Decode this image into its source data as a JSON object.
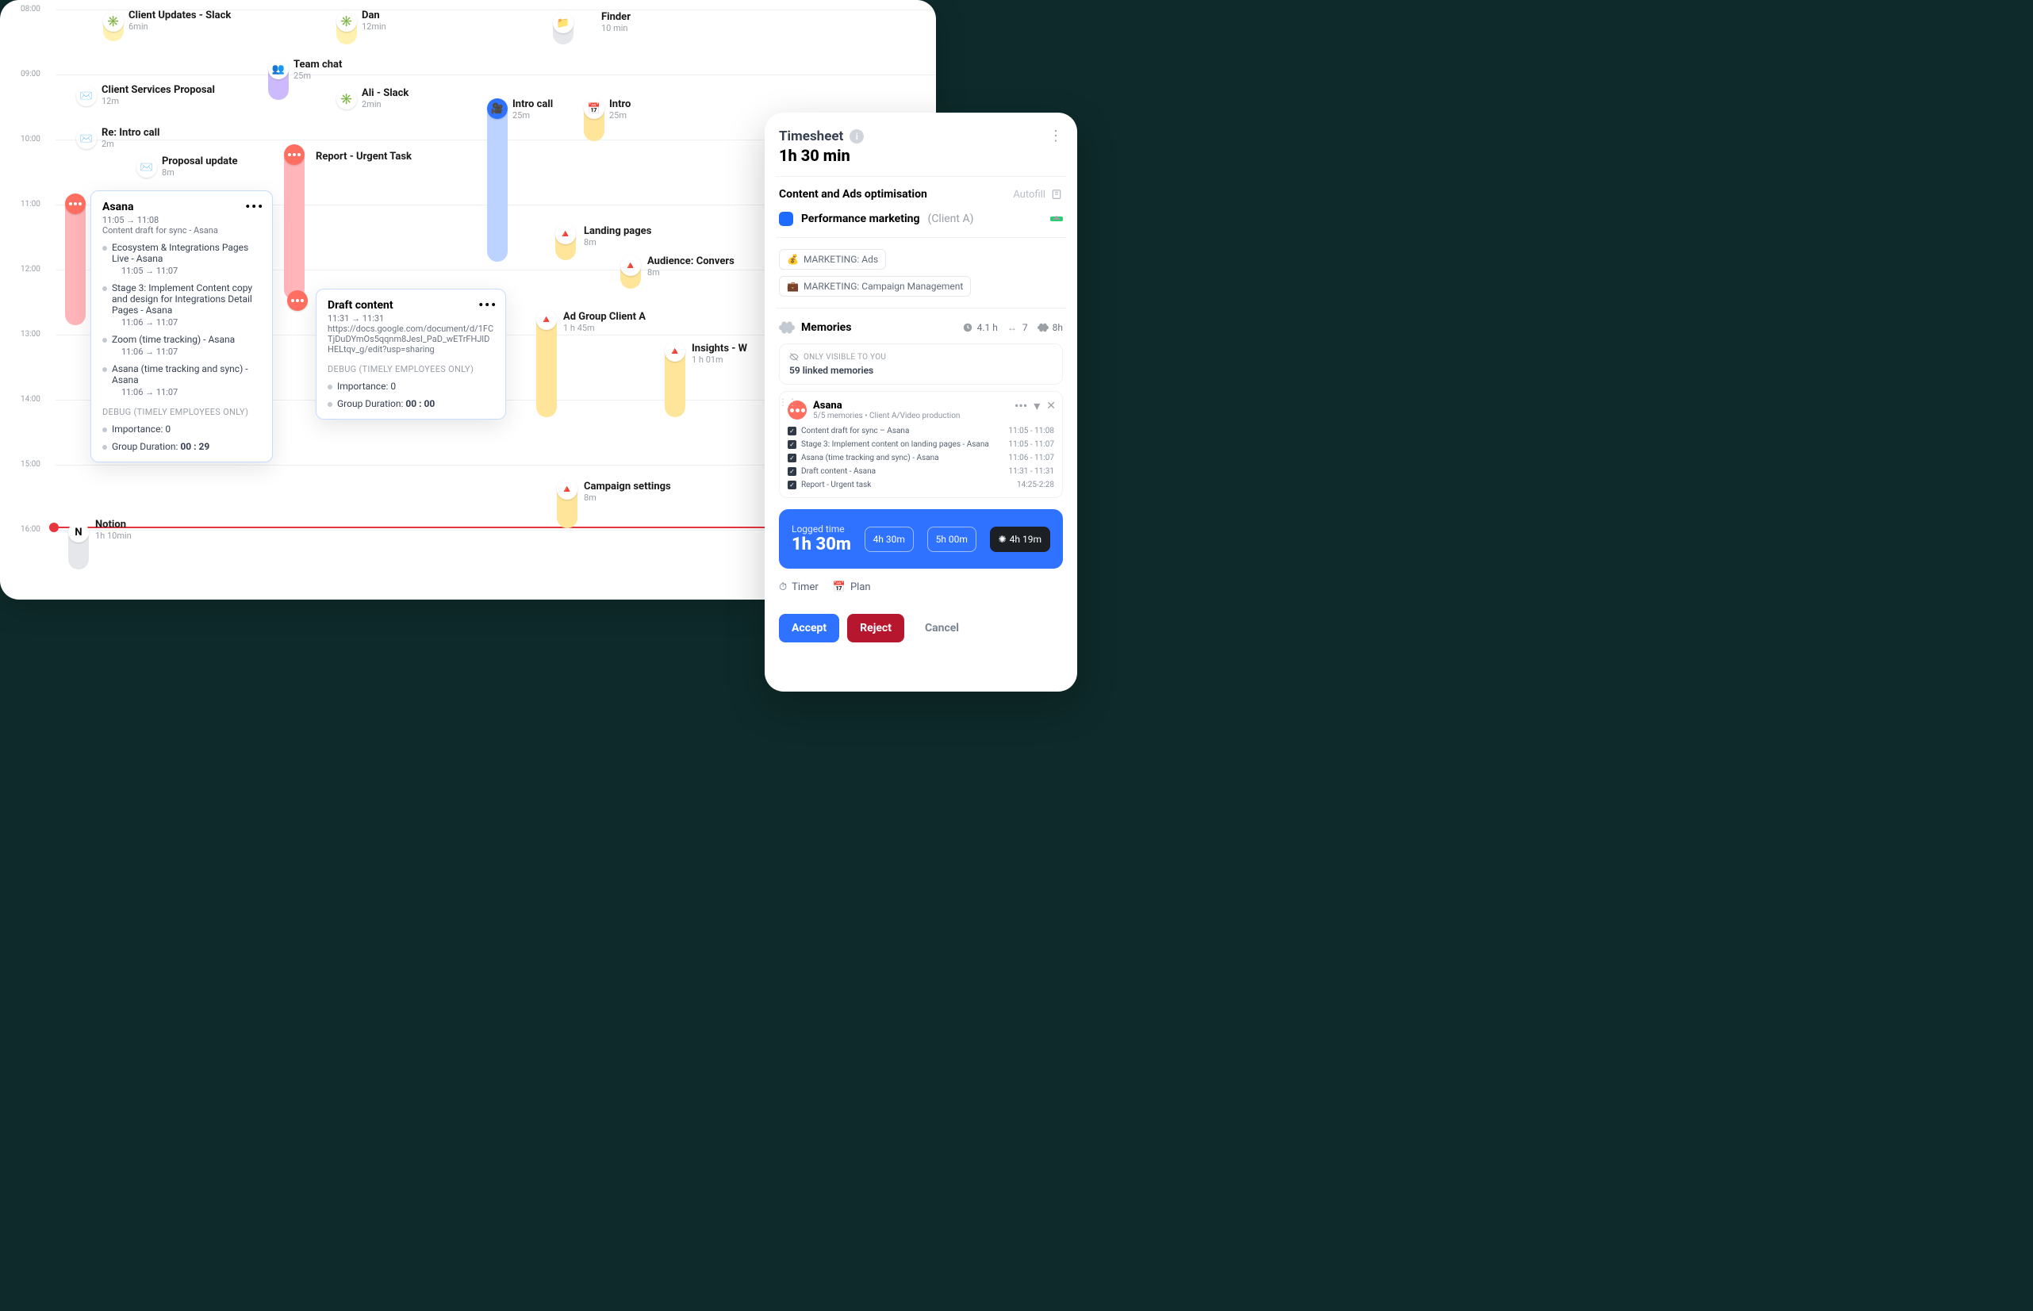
{
  "timeline": {
    "hours": [
      "08:00",
      "09:00",
      "10:00",
      "11:00",
      "12:00",
      "13:00",
      "14:00",
      "15:00",
      "16:00"
    ],
    "events": {
      "e1": {
        "title": "Client Updates - Slack",
        "sub": "6min"
      },
      "e2": {
        "title": "Dan",
        "sub": "12min"
      },
      "e3": {
        "title": "Finder",
        "sub": "10 min"
      },
      "e4": {
        "title": "Team chat",
        "sub": "25m"
      },
      "e5": {
        "title": "Client Services Proposal",
        "sub": "12m"
      },
      "e6": {
        "title": "Ali - Slack",
        "sub": "2min"
      },
      "e7": {
        "title": "Intro call",
        "sub": "25m"
      },
      "e8": {
        "title": "Intro",
        "sub": "25m"
      },
      "e9": {
        "title": "Re: Intro call",
        "sub": "2m"
      },
      "e10": {
        "title": "Proposal update",
        "sub": "8m"
      },
      "e11": {
        "title": "Report - Urgent Task",
        "sub": ""
      },
      "e12": {
        "title": "Landing pages",
        "sub": "8m"
      },
      "e13": {
        "title": "Audience: Convers",
        "sub": "8m"
      },
      "e14": {
        "title": "Ad Group Client A",
        "sub": "1 h 45m"
      },
      "e15": {
        "title": "Insights - W",
        "sub": "1 h 01m"
      },
      "e16": {
        "title": "Campaign settings",
        "sub": "8m"
      },
      "e17": {
        "title": "Notion",
        "sub": "1h 10min"
      }
    },
    "popoverA": {
      "title": "Asana",
      "time": "11:05 → 11:08",
      "sub": "Content draft for sync - Asana",
      "items": [
        {
          "t": "Ecosystem & Integrations Pages Live - Asana",
          "time": "11:05 → 11:07"
        },
        {
          "t": "Stage 3: Implement Content copy and design for Integrations Detail Pages - Asana",
          "time": "11:06 → 11:07"
        },
        {
          "t": "Zoom (time tracking) - Asana",
          "time": "11:06 → 11:07"
        },
        {
          "t": "Asana (time tracking and sync) - Asana",
          "time": "11:06 → 11:07"
        }
      ],
      "debug": "DEBUG (TIMELY EMPLOYEES ONLY)",
      "importance_label": "Importance:",
      "importance": "0",
      "groupdur_label": "Group Duration:",
      "groupdur": "00 : 29"
    },
    "popoverB": {
      "title": "Draft content",
      "time": "11:31 → 11:31",
      "url": "https://docs.google.com/document/d/1FCTjDuDYmOs5qqnm8JesI_PaD_wETrFHJlDHELtqv_g/edit?usp=sharing",
      "debug": "DEBUG (TIMELY EMPLOYEES ONLY)",
      "importance_label": "Importance:",
      "importance": "0",
      "groupdur_label": "Group Duration:",
      "groupdur": "00 : 00"
    }
  },
  "sheet": {
    "title": "Timesheet",
    "duration": "1h 30 min",
    "section": "Content and Ads optimisation",
    "autofill": "Autofill",
    "project": {
      "name": "Performance marketing",
      "client": "(Client A)"
    },
    "chips": [
      {
        "icon": "💰",
        "label": "MARKETING: Ads"
      },
      {
        "icon": "💼",
        "label": "MARKETING: Campaign Management"
      }
    ],
    "memories_label": "Memories",
    "stats": {
      "hours": "4.1 h",
      "count": "7",
      "total": "8h"
    },
    "linked": {
      "vis": "ONLY VISIBLE TO YOU",
      "text": "59 linked memories"
    },
    "memcard": {
      "title": "Asana",
      "sub": "5/5 memories • Client A/Video production",
      "rows": [
        {
          "t": "Content draft for sync – Asana",
          "time": "11:05 - 11:08"
        },
        {
          "t": "Stage 3: Implement content on landing pages  - Asana",
          "time": "11:05 - 11:07"
        },
        {
          "t": "Asana (time tracking and sync) - Asana",
          "time": "11:06 - 11:07"
        },
        {
          "t": "Draft content - Asana",
          "time": "11:31 - 11:31"
        },
        {
          "t": "Report - Urgent task",
          "time": "14:25-2:28"
        }
      ]
    },
    "logged": {
      "label": "Logged time",
      "value": "1h  30m",
      "b1": "4h 30m",
      "b2": "5h 00m",
      "b3": "4h 19m"
    },
    "footer": {
      "timer": "Timer",
      "plan": "Plan"
    },
    "actions": {
      "accept": "Accept",
      "reject": "Reject",
      "cancel": "Cancel"
    }
  }
}
